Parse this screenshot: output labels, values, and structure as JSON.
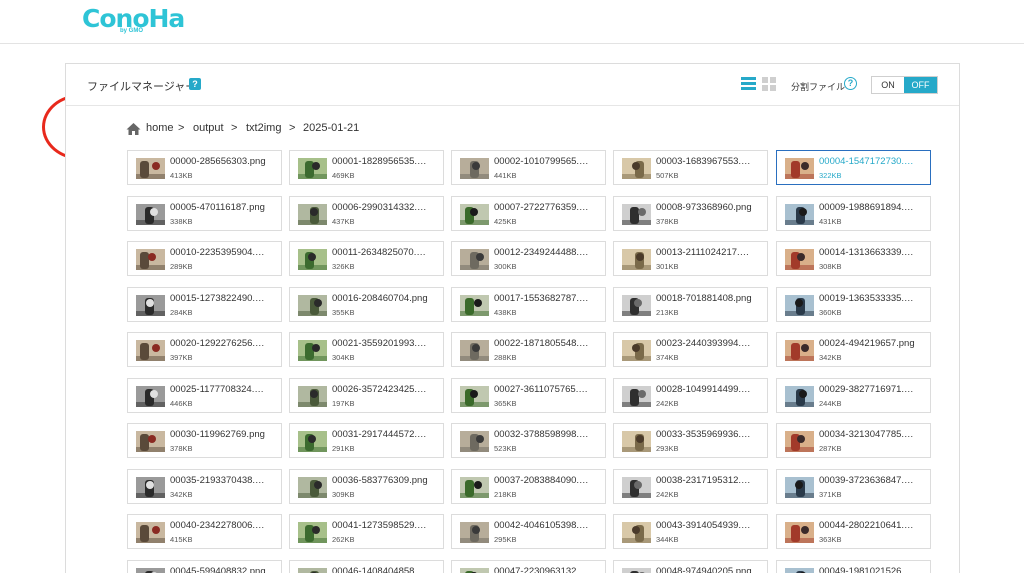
{
  "header": {
    "logo_text": "ConoHa",
    "logo_sub": "by GMO"
  },
  "panel": {
    "title": "ファイルマネージャー",
    "help_icon": "?",
    "split_label": "分割ファイル",
    "split_help_icon": "?",
    "toggle_on": "ON",
    "toggle_off": "OFF"
  },
  "sidebar": {
    "upload_icon": "upload-icon",
    "download_icon": "download-icon",
    "delete_icon": "trash-icon",
    "new_folder_icon": "folder-add-icon"
  },
  "breadcrumb": {
    "items": [
      "home",
      "output",
      "txt2img",
      "2025-01-21"
    ],
    "separator": ">"
  },
  "colors": {
    "accent": "#26a9c9",
    "annotation": "#e8291c",
    "selected_border": "#2a6fbf"
  },
  "selected_index": 4,
  "files": [
    {
      "name": "00000-285656303.png",
      "size": "413KB"
    },
    {
      "name": "00001-1828956535.…",
      "size": "469KB"
    },
    {
      "name": "00002-1010799565.…",
      "size": "441KB"
    },
    {
      "name": "00003-1683967553.…",
      "size": "507KB"
    },
    {
      "name": "00004-1547172730.…",
      "size": "322KB"
    },
    {
      "name": "00005-470116187.png",
      "size": "338KB"
    },
    {
      "name": "00006-2990314332.…",
      "size": "437KB"
    },
    {
      "name": "00007-2722776359.…",
      "size": "425KB"
    },
    {
      "name": "00008-973368960.png",
      "size": "378KB"
    },
    {
      "name": "00009-1988691894.…",
      "size": "431KB"
    },
    {
      "name": "00010-2235395904.…",
      "size": "289KB"
    },
    {
      "name": "00011-2634825070.…",
      "size": "326KB"
    },
    {
      "name": "00012-2349244488.…",
      "size": "300KB"
    },
    {
      "name": "00013-2111024217.…",
      "size": "301KB"
    },
    {
      "name": "00014-1313663339.…",
      "size": "308KB"
    },
    {
      "name": "00015-1273822490.…",
      "size": "284KB"
    },
    {
      "name": "00016-208460704.png",
      "size": "355KB"
    },
    {
      "name": "00017-1553682787.…",
      "size": "438KB"
    },
    {
      "name": "00018-701881408.png",
      "size": "213KB"
    },
    {
      "name": "00019-1363533335.…",
      "size": "360KB"
    },
    {
      "name": "00020-1292276256.…",
      "size": "397KB"
    },
    {
      "name": "00021-3559201993.…",
      "size": "304KB"
    },
    {
      "name": "00022-1871805548.…",
      "size": "288KB"
    },
    {
      "name": "00023-2440393994.…",
      "size": "374KB"
    },
    {
      "name": "00024-494219657.png",
      "size": "342KB"
    },
    {
      "name": "00025-1177708324.…",
      "size": "446KB"
    },
    {
      "name": "00026-3572423425.…",
      "size": "197KB"
    },
    {
      "name": "00027-3611075765.…",
      "size": "365KB"
    },
    {
      "name": "00028-1049914499.…",
      "size": "242KB"
    },
    {
      "name": "00029-3827716971.…",
      "size": "244KB"
    },
    {
      "name": "00030-119962769.png",
      "size": "378KB"
    },
    {
      "name": "00031-2917444572.…",
      "size": "291KB"
    },
    {
      "name": "00032-3788598998.…",
      "size": "523KB"
    },
    {
      "name": "00033-3535969936.…",
      "size": "293KB"
    },
    {
      "name": "00034-3213047785.…",
      "size": "287KB"
    },
    {
      "name": "00035-2193370438.…",
      "size": "342KB"
    },
    {
      "name": "00036-583776309.png",
      "size": "309KB"
    },
    {
      "name": "00037-2083884090.…",
      "size": "218KB"
    },
    {
      "name": "00038-2317195312.…",
      "size": "242KB"
    },
    {
      "name": "00039-3723636847.…",
      "size": "371KB"
    },
    {
      "name": "00040-2342278006.…",
      "size": "415KB"
    },
    {
      "name": "00041-1273598529.…",
      "size": "262KB"
    },
    {
      "name": "00042-4046105398.…",
      "size": "295KB"
    },
    {
      "name": "00043-3914054939.…",
      "size": "344KB"
    },
    {
      "name": "00044-2802210641.…",
      "size": "363KB"
    },
    {
      "name": "00045-599408832.png",
      "size": ""
    },
    {
      "name": "00046-1408404858.…",
      "size": ""
    },
    {
      "name": "00047-2230963132.…",
      "size": ""
    },
    {
      "name": "00048-974940205.png",
      "size": ""
    },
    {
      "name": "00049-1981021526.…",
      "size": ""
    }
  ]
}
